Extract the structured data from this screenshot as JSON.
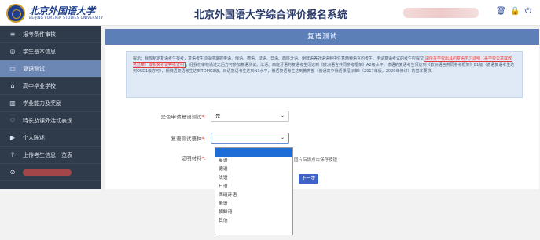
{
  "header": {
    "logo_cn": "北京外国语大学",
    "logo_en": "BEIJING FOREIGN STUDIES UNIVERSITY",
    "system_title": "北京外国语大学综合评价报名系统"
  },
  "sidebar": {
    "items": [
      {
        "label": "报考条件审核",
        "icon": "list-icon"
      },
      {
        "label": "学生基本信息",
        "icon": "user-icon"
      },
      {
        "label": "复语测试",
        "icon": "monitor-icon",
        "active": true
      },
      {
        "label": "高中毕业学校",
        "icon": "graduation-cap-icon"
      },
      {
        "label": "学业能力及奖励",
        "icon": "book-icon"
      },
      {
        "label": "特长及课外活动表现",
        "icon": "heart-icon"
      },
      {
        "label": "个人陈述",
        "icon": "video-icon"
      },
      {
        "label": "上传考生信息一览表",
        "icon": "upload-icon"
      }
    ]
  },
  "main": {
    "title": "复语测试",
    "notice": {
      "p1": "提示：我校制定复语考生报考，复语考生须提供掌握英语、俄语、德语、法语、日语、西班牙语、朝鲜语等外语语种中任意两种语言的考生。申请复语考试的考生应提交",
      "p1_boxed": "由所在学校出具的复语学习证明（盖学校公章或教务处章）或相关考试等级证明",
      "p1_tail": "，经我校审核通过之后方可参加复语测试。",
      "p2": "法语、西班牙语的复语考生须达到《欧洲语言共同参考框架》A2级水平，德语的复语考生须达到《欧洲语言共同参考框架》B1级（德语复语考生达到OSD1级亦可），朝鲜语复语考生达到TOPIK3级，日语复语考生达到N3水平，俄语复语考生达到教育部《普通高中俄语课程标准》（2017年版，2020年修订）的基本要求。"
    },
    "fields": {
      "apply_label": "是否申请复语测试",
      "apply_value": "是",
      "lang_label": "复语测试语种",
      "lang_value": "",
      "material_label": "证明材料"
    },
    "language_options": [
      "",
      "英语",
      "德语",
      "法语",
      "日语",
      "西班牙语",
      "俄语",
      "朝鲜语",
      "其他"
    ],
    "upload_hint": "图片后请点击保存按钮",
    "next_button": "下一步",
    "required_mark": "*:"
  },
  "colors": {
    "sidebar_bg": "#2f3a4a",
    "sidebar_active": "#6d87b5",
    "title_bar": "#5c7fb7",
    "notice_bg": "#dfeaf6",
    "accent_red": "#e23b3b",
    "button": "#3f63c7"
  }
}
